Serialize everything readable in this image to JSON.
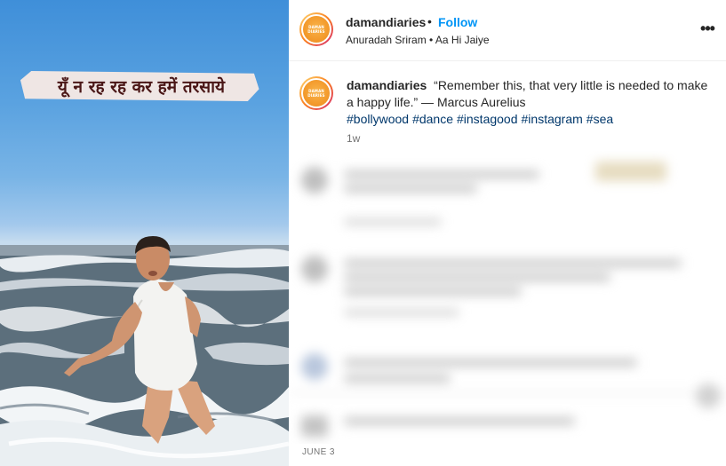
{
  "media": {
    "caption": "यूँ न रह रह कर हमें तरसाये",
    "colors": {
      "sky_top": "#3f8fd9",
      "sea": "#5c6f7c",
      "foam": "#eef2f5",
      "caption_band": "#efe6e4",
      "caption_text": "#4a1616"
    }
  },
  "header": {
    "avatar_text_line1": "DAMAN",
    "avatar_text_line2": "DIARIES",
    "username": "damandiaries",
    "separator": "•",
    "follow_label": "Follow",
    "audio": "Anuradah Sriram • Aa Hi Jaiye",
    "more_icon": "•••"
  },
  "post": {
    "username": "damandiaries",
    "caption": "“Remember this, that very little is needed to make a happy life.” — Marcus Aurelius",
    "hashtags": [
      "#bollywood",
      "#dance",
      "#instagood",
      "#instagram",
      "#sea"
    ],
    "age": "1w"
  },
  "footer": {
    "date": "JUNE 3"
  },
  "colors": {
    "link_blue": "#0095f6",
    "hashtag": "#00376b",
    "text": "#262626",
    "muted": "#737373"
  }
}
